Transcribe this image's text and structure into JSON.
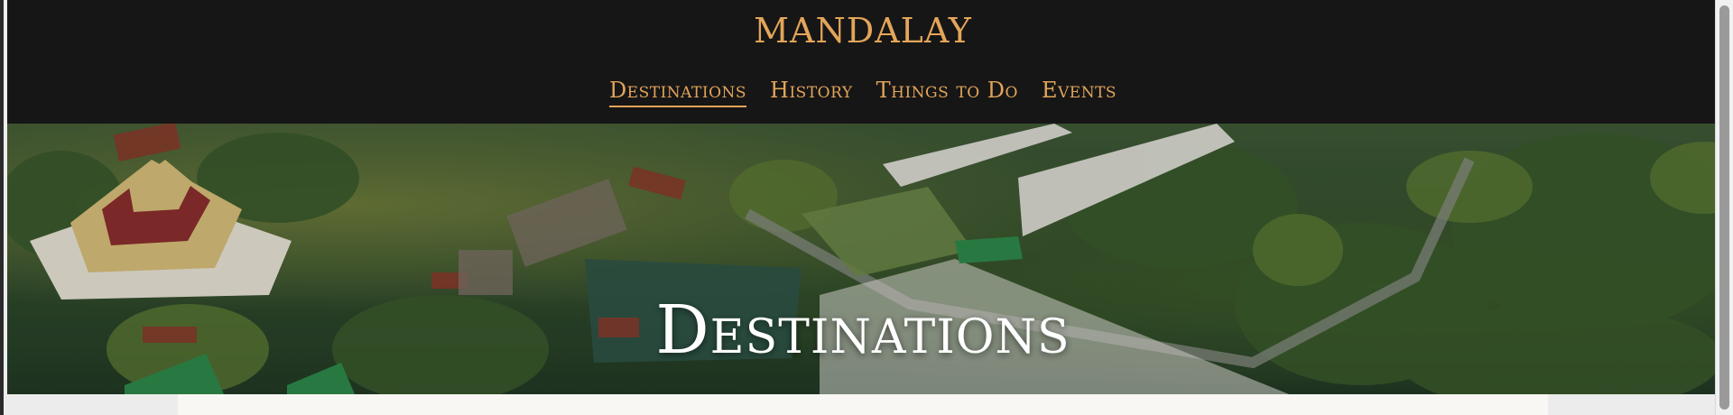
{
  "site": {
    "brand": "MANDALAY",
    "brand_color": "#e2a55a",
    "header_bg": "#171616"
  },
  "nav": {
    "items": [
      {
        "label": "Destinations",
        "active": true
      },
      {
        "label": "History",
        "active": false
      },
      {
        "label": "Things to Do",
        "active": false
      },
      {
        "label": "Events",
        "active": false
      }
    ]
  },
  "hero": {
    "title": "Destinations",
    "image": "aerial-mandalay-pagodas-photo"
  }
}
